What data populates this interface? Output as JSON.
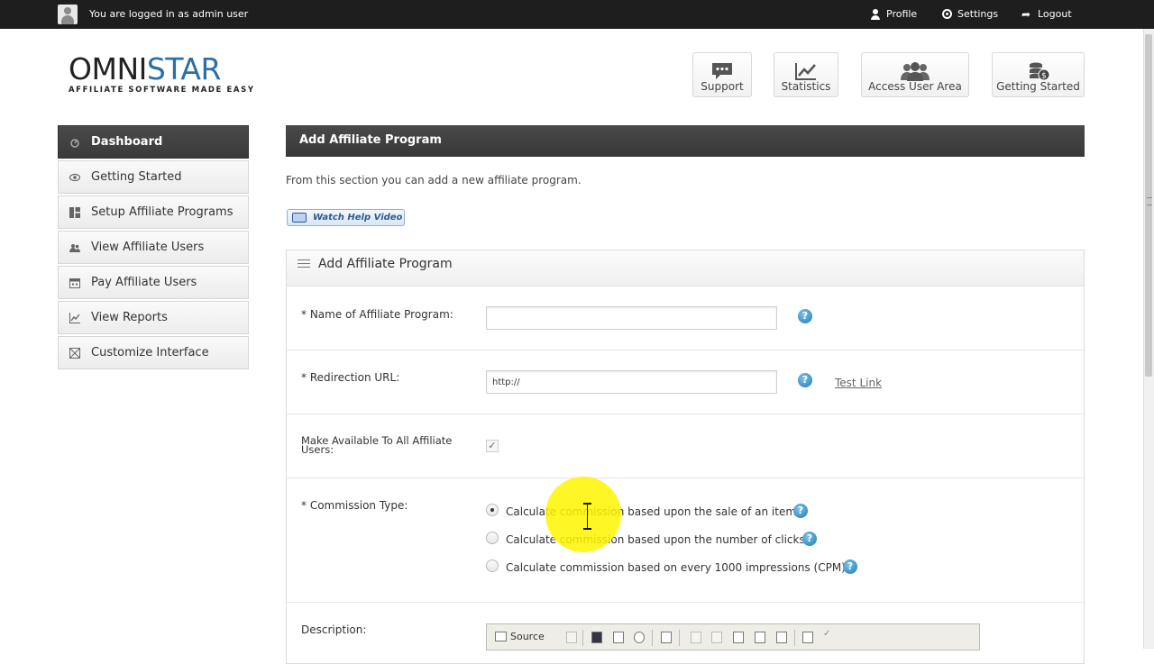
{
  "topbar": {
    "login_text": "You are logged in as admin user",
    "profile": "Profile",
    "settings": "Settings",
    "logout": "Logout"
  },
  "logo": {
    "brand_left": "OMNI",
    "brand_right": "STAR",
    "tagline": "AFFILIATE SOFTWARE MADE EASY"
  },
  "header_buttons": {
    "support": "Support",
    "statistics": "Statistics",
    "access_user_area": "Access User Area",
    "getting_started": "Getting Started"
  },
  "sidebar": {
    "items": [
      {
        "label": "Dashboard"
      },
      {
        "label": "Getting Started"
      },
      {
        "label": "Setup Affiliate Programs"
      },
      {
        "label": "View Affiliate Users"
      },
      {
        "label": "Pay Affiliate Users"
      },
      {
        "label": "View Reports"
      },
      {
        "label": "Customize Interface"
      }
    ]
  },
  "main": {
    "title": "Add Affiliate Program",
    "intro": "From this section you can add a new affiliate program.",
    "help_video": "Watch Help Video"
  },
  "form": {
    "title": "Add Affiliate Program",
    "name_label": "* Name of Affiliate Program:",
    "name_value": "",
    "url_label": "* Redirection URL:",
    "url_value": "http://",
    "test_link": "Test Link",
    "available_label": "Make Available To All Affiliate Users:",
    "available_checked": true,
    "check_mark": "✓",
    "commission_label": "* Commission Type:",
    "commission_options": [
      {
        "label": "Calculate commission based upon the sale of an item",
        "checked": true
      },
      {
        "label": "Calculate commission based upon the number of clicks",
        "checked": false
      },
      {
        "label": "Calculate commission based on every 1000 impressions (CPM)",
        "checked": false
      }
    ],
    "description_label": "Description:",
    "editor_source": "Source",
    "help_glyph": "?"
  },
  "colors": {
    "topbar_bg": "#1e1e1e",
    "panel_header_bg": "#3f3f3f",
    "help_icon": "#1f79b6",
    "brand_accent": "#2a6fa8",
    "cursor_highlight": "#fff500"
  }
}
